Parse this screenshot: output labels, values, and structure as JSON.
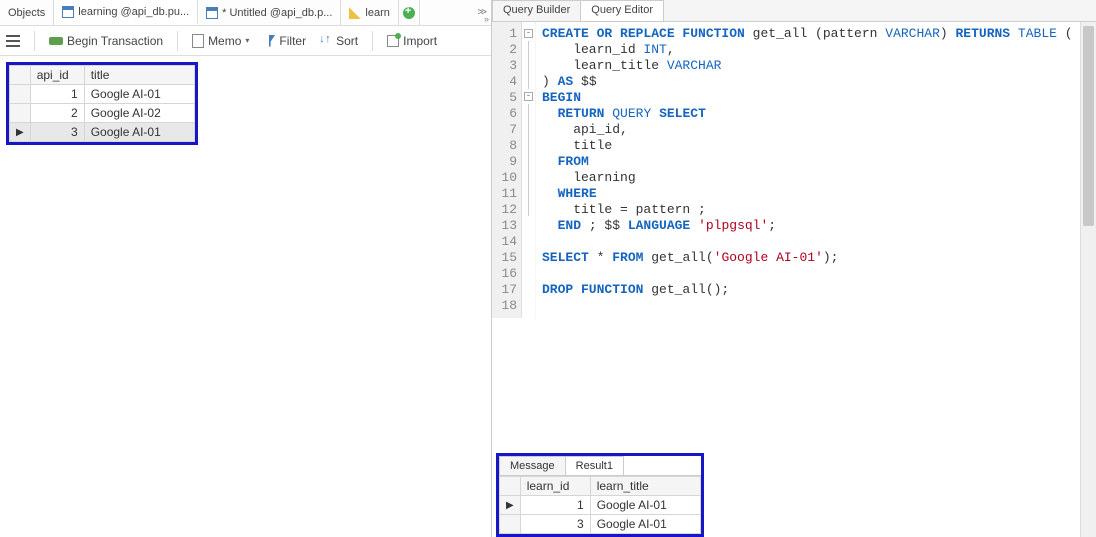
{
  "left": {
    "tabs": [
      {
        "label": "Objects"
      },
      {
        "label": "learning @api_db.pu..."
      },
      {
        "label": "* Untitled @api_db.p..."
      },
      {
        "label": "learn"
      }
    ],
    "toolbar": {
      "begin_tx": "Begin Transaction",
      "memo": "Memo",
      "filter": "Filter",
      "sort": "Sort",
      "import": "Import"
    },
    "grid": {
      "cols": [
        "api_id",
        "title"
      ],
      "rows": [
        {
          "id": "1",
          "title": "Google AI-01"
        },
        {
          "id": "2",
          "title": "Google AI-02"
        },
        {
          "id": "3",
          "title": "Google AI-01"
        }
      ]
    }
  },
  "right": {
    "tabs": {
      "builder": "Query Builder",
      "editor": "Query Editor"
    },
    "code_lines": [
      "CREATE OR REPLACE FUNCTION get_all (pattern VARCHAR) RETURNS TABLE (",
      "    learn_id INT,",
      "    learn_title VARCHAR",
      ") AS $$",
      "BEGIN",
      "  RETURN QUERY SELECT",
      "    api_id,",
      "    title",
      "  FROM",
      "    learning",
      "  WHERE",
      "    title = pattern ;",
      "  END ; $$ LANGUAGE 'plpgsql';",
      "",
      "SELECT * FROM get_all('Google AI-01');",
      "",
      "DROP FUNCTION get_all();",
      ""
    ],
    "result_tabs": {
      "message": "Message",
      "result1": "Result1"
    },
    "result_grid": {
      "cols": [
        "learn_id",
        "learn_title"
      ],
      "rows": [
        {
          "id": "1",
          "title": "Google AI-01"
        },
        {
          "id": "3",
          "title": "Google AI-01"
        }
      ]
    }
  }
}
